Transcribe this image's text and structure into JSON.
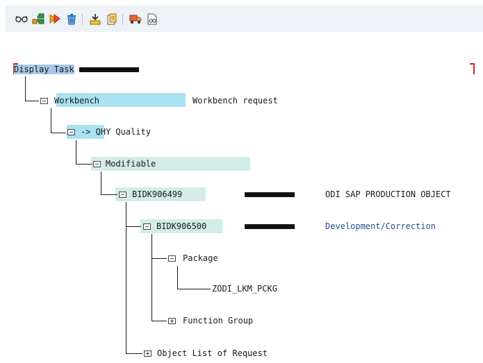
{
  "toolbar": {
    "icons": [
      "glasses-icon",
      "hierarchy-icon",
      "activate-icon",
      "trash-icon",
      "import-icon",
      "new-document-icon",
      "truck-icon",
      "display-object-icon"
    ]
  },
  "tree": {
    "root_label": "Display Task",
    "workbench": {
      "label": "Workbench",
      "description": "Workbench request"
    },
    "target": {
      "label": "-> QHY",
      "description": "Quality"
    },
    "status": {
      "label": "Modifiable"
    },
    "request": {
      "id": "BIDK906499",
      "description": "ODI SAP PRODUCTION OBJECT"
    },
    "task": {
      "id": "BIDK906500",
      "description": "Development/Correction"
    },
    "package": {
      "label": "Package",
      "child": "ZODI_LKM_PCKG"
    },
    "function_group": {
      "label": "Function Group"
    },
    "object_list": {
      "label": "Object List of Request"
    }
  },
  "colors": {
    "highlight": "#a9e2f3",
    "highlight_soft": "#d3ece8",
    "link_blue": "#1f4e8c",
    "toolbar_bg": "#eef1f5"
  }
}
